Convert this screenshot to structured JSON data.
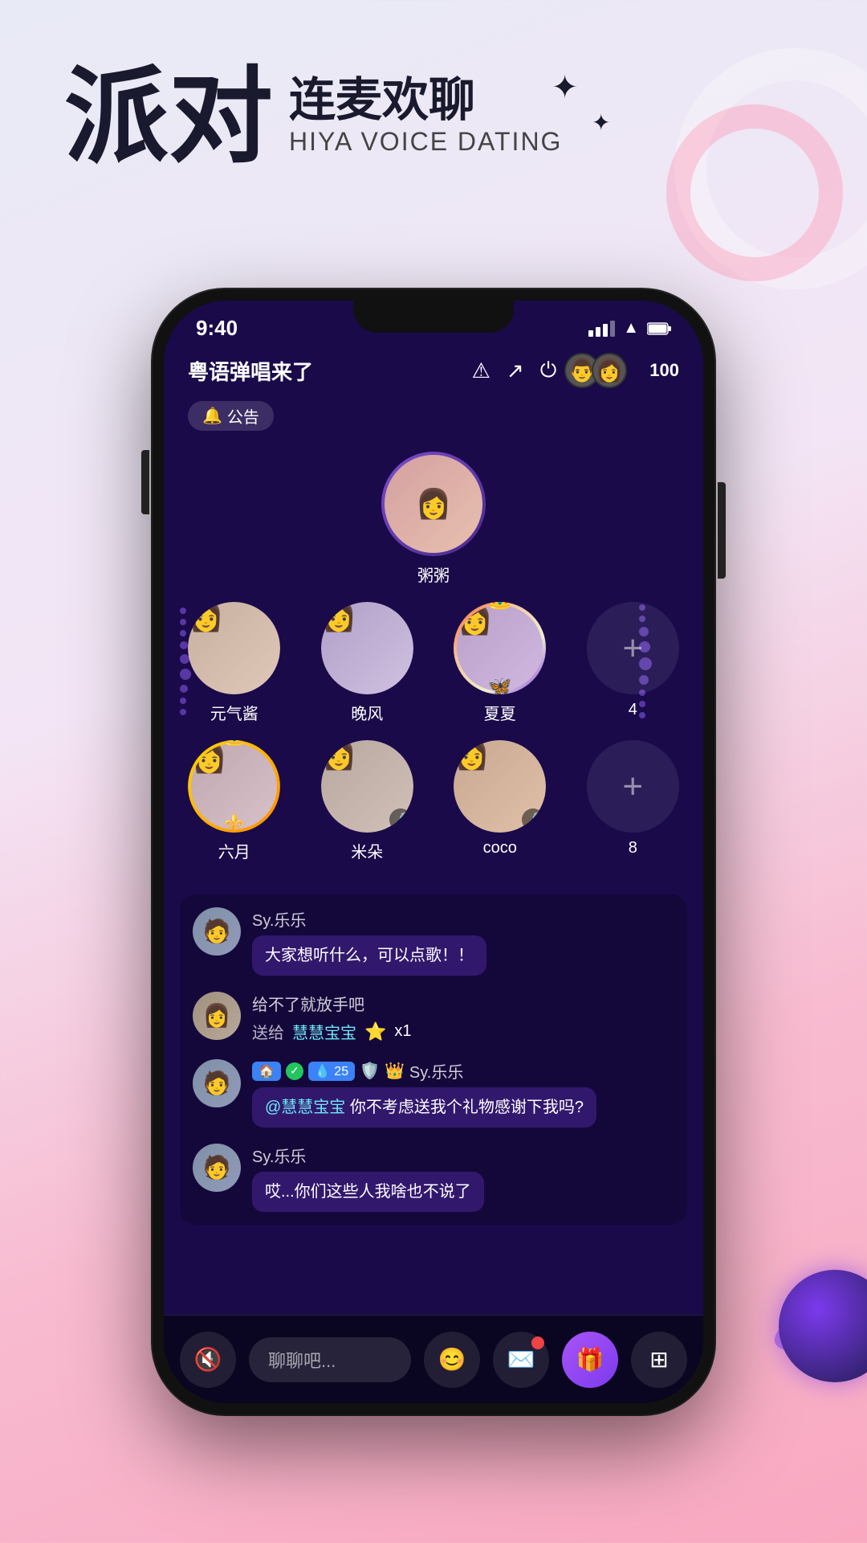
{
  "app": {
    "title": "派对连麦欢聊",
    "subtitle_cn": "连麦欢聊",
    "subtitle_en": "HIYA VOICE DATING",
    "heading_big": "派对"
  },
  "phone": {
    "status_bar": {
      "time": "9:40",
      "signal": 3,
      "wifi": true,
      "battery": true
    },
    "room": {
      "title": "粤语弹唱来了",
      "notice_label": "公告",
      "audience_count": "100"
    },
    "host": {
      "name": "粥粥"
    },
    "mic_slots_row1": [
      {
        "name": "元气酱",
        "type": "normal"
      },
      {
        "name": "晚风",
        "type": "normal"
      },
      {
        "name": "夏夏",
        "type": "special"
      }
    ],
    "add_slot_row1": {
      "number": "4"
    },
    "mic_slots_row2": [
      {
        "name": "六月",
        "type": "crown"
      },
      {
        "name": "米朵",
        "type": "badge"
      },
      {
        "name": "coco",
        "type": "badge"
      }
    ],
    "add_slot_row2": {
      "number": "8"
    },
    "chat": [
      {
        "username": "Sy.乐乐",
        "message": "大家想听什么，可以点歌！！",
        "type": "text"
      },
      {
        "username": "",
        "gift_from": "给不了就放手吧",
        "gift_to": "慧慧宝宝",
        "gift_name": "★",
        "gift_count": "x1",
        "type": "gift"
      },
      {
        "username": "Sy.乐乐",
        "badges": [
          "home",
          "check",
          "25",
          "shield",
          "crown"
        ],
        "mention": "@慧慧宝宝",
        "message": "你不考虑送我个礼物感谢下我吗?",
        "type": "mention"
      },
      {
        "username": "Sy.乐乐",
        "message": "哎...你们这些人我啥也不说了",
        "type": "text"
      }
    ],
    "bottom_bar": {
      "chat_placeholder": "聊聊吧...",
      "icons": [
        "emoji",
        "envelope",
        "gift",
        "grid"
      ]
    }
  }
}
